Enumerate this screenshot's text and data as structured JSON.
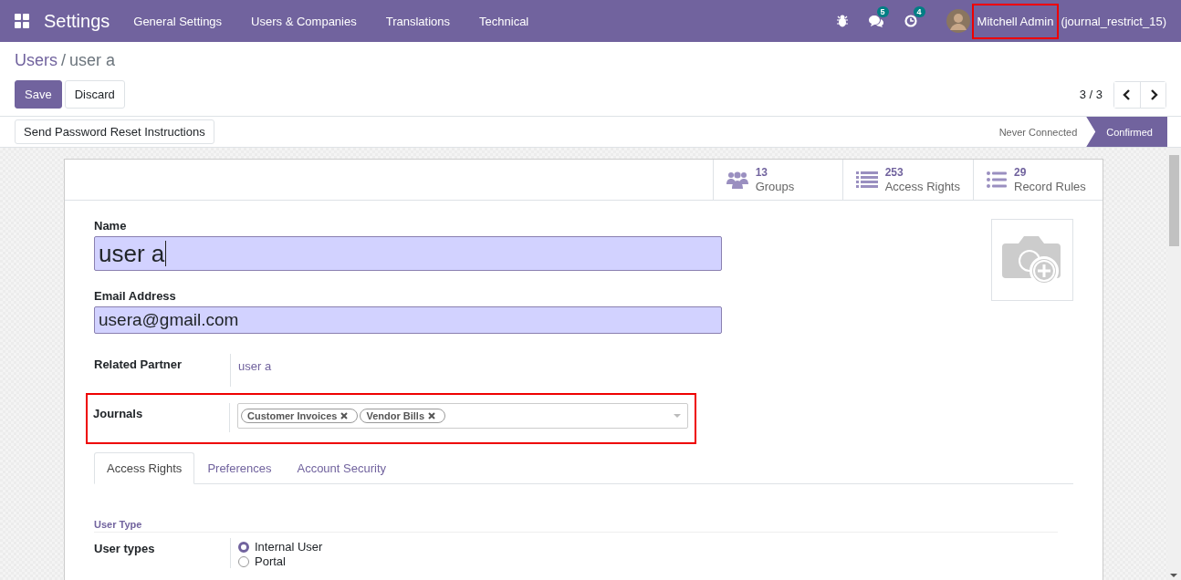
{
  "navbar": {
    "app_name": "Settings",
    "menus": [
      "General Settings",
      "Users & Companies",
      "Translations",
      "Technical"
    ],
    "messages_count": "5",
    "activities_count": "4",
    "user_name": "Mitchell Admin",
    "database": "(journal_restrict_15)"
  },
  "breadcrumb": [
    "Users",
    "user a"
  ],
  "breadcrumb_separator": "/",
  "buttons": [
    "Save",
    "Discard"
  ],
  "pager": "3 / 3",
  "header_buttons": [
    "Send Password Reset Instructions"
  ],
  "stages": [
    {
      "label": "Never Connected",
      "selected": false
    },
    {
      "label": "Confirmed",
      "selected": true
    }
  ],
  "smart_buttons": [
    {
      "kind": "groups",
      "count": "13",
      "label": "Groups"
    },
    {
      "kind": "rights",
      "count": "253",
      "label": "Access Rights"
    },
    {
      "kind": "rules",
      "count": "29",
      "label": "Record Rules"
    }
  ],
  "name": {
    "label": "Name",
    "value": "user a"
  },
  "email": {
    "label": "Email Address",
    "value": "usera@gmail.com"
  },
  "related_partner": {
    "label": "Related Partner",
    "value": "user a"
  },
  "journals": {
    "label": "Journals",
    "tags": [
      "Customer Invoices",
      "Vendor Bills"
    ]
  },
  "tabs": [
    {
      "label": "Access Rights",
      "selected": true
    },
    {
      "label": "Preferences",
      "selected": false
    },
    {
      "label": "Account Security",
      "selected": false
    }
  ],
  "section_title": "User Type",
  "user_types": {
    "label": "User types",
    "options": [
      {
        "label": "Internal User",
        "selected": true
      },
      {
        "label": "Portal",
        "selected": false
      }
    ]
  }
}
